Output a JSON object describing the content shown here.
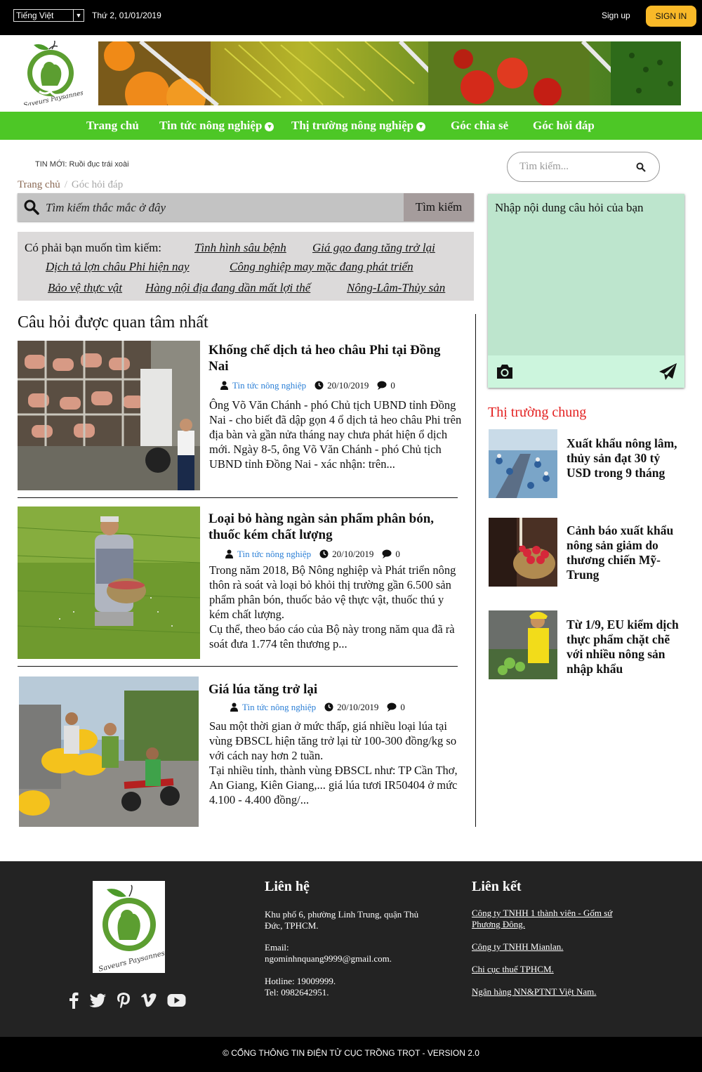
{
  "topbar": {
    "language": "Tiếng Việt",
    "date": "Thứ 2, 01/01/2019",
    "signup": "Sign up",
    "signin": "SIGN IN"
  },
  "nav": {
    "items": [
      "Trang chủ",
      "Tin tức nông nghiệp",
      "Thị trường nông nghiệp",
      "Góc chia sẻ",
      "Góc hỏi đáp"
    ]
  },
  "ticker": "TIN MỚI: Ruồi đục trái xoài",
  "search_top": {
    "placeholder": "Tìm kiếm..."
  },
  "breadcrumb": {
    "home": "Trang chủ",
    "sep": "/",
    "current": "Góc hỏi đáp"
  },
  "qa_search": {
    "placeholder": "Tìm kiếm thắc mắc ở đây",
    "button": "Tìm kiếm"
  },
  "suggest": {
    "label": "Có phải bạn muốn tìm kiếm:",
    "items": [
      "Tình hình sâu bệnh",
      "Giá gạo đang tăng trở lại",
      "Dịch tả lợn châu Phi hiện nay",
      "Công nghiệp may mặc đang phát triển",
      "Bảo vệ thực vật",
      "Hàng nội địa đang dần mất lợi thế",
      "Nông-Lâm-Thủy sản"
    ]
  },
  "section_title": "Câu hỏi được quan tâm nhất",
  "articles": [
    {
      "title": "Khống chế dịch tả heo châu Phi tại Đồng Nai",
      "category": "Tin tức nông nghiệp",
      "date": "20/10/2019",
      "comments": "0",
      "excerpt": "Ông Võ Văn Chánh - phó Chủ tịch UBND tỉnh Đồng Nai - cho biết đã dập gọn 4 ổ dịch tả heo châu Phi trên địa bàn và gần nửa tháng nay chưa phát hiện ổ dịch mới. Ngày 8-5, ông Võ Văn Chánh - phó Chủ tịch UBND tỉnh Đồng Nai - xác nhận: trên..."
    },
    {
      "title": "Loại bỏ hàng ngàn sản phẩm phân bón, thuốc kém chất lượng",
      "category": "Tin tức nông nghiệp",
      "date": "20/10/2019",
      "comments": "0",
      "excerpt": "Trong năm 2018, Bộ Nông nghiệp và Phát triển nông thôn rà soát và loại bỏ khỏi thị trường gần 6.500 sản phẩm phân bón, thuốc bảo vệ thực vật, thuốc thú y kém chất lượng.",
      "excerpt2": "Cụ thể, theo báo cáo của Bộ này trong năm qua đã rà soát đưa 1.774 tên thương p..."
    },
    {
      "title": "Giá lúa tăng trở lại",
      "category": "Tin tức nông nghiệp",
      "date": "20/10/2019",
      "comments": "0",
      "excerpt": "Sau một thời gian ở mức thấp, giá nhiều loại lúa tại vùng ĐBSCL hiện tăng trở lại từ 100-300 đồng/kg so với cách nay hơn 2 tuần.",
      "excerpt2": "Tại nhiều tỉnh, thành vùng ĐBSCL như: TP Cần Thơ, An Giang, Kiên Giang,... giá lúa tươi IR50404 ở mức 4.100 - 4.400 đồng/..."
    }
  ],
  "ask_box": {
    "placeholder": "Nhập nội dung câu hỏi của bạn"
  },
  "market": {
    "title": "Thị trường chung",
    "items": [
      "Xuất khẩu nông lâm, thủy sản đạt 30 tỷ USD trong 9 tháng",
      "Cảnh báo xuất khẩu nông sản giảm do thương chiến Mỹ- Trung",
      "Từ 1/9, EU kiểm dịch thực phẩm chặt chẽ với nhiều nông sản nhập khẩu"
    ]
  },
  "footer": {
    "contact_title": "Liên hệ",
    "address": "Khu phố 6, phường Linh Trung, quận Thủ Đức, TPHCM.",
    "email_label": "Email:",
    "email": "ngominhnquang9999@gmail.com.",
    "hotline": "Hotline: 19009999.",
    "tel": "Tel: 0982642951.",
    "links_title": "Liên kết",
    "links": [
      "Công ty TNHH 1 thành viên - Gốm sứ Phương Đông.",
      "Công ty TNHH Mianlan.",
      "Chi cục thuế TPHCM.",
      "Ngân hàng NN&PTNT Việt Nam."
    ],
    "copyright": "© CỔNG THÔNG TIN ĐIỆN TỬ CỤC TRỒNG TRỌT - VERSION 2.0"
  },
  "colors": {
    "nav_green": "#4dc726",
    "signin_yellow": "#f9b928",
    "market_red": "#e32020",
    "link_blue": "#2b7fd6"
  },
  "logo_text": "Saveurs Paysannes"
}
